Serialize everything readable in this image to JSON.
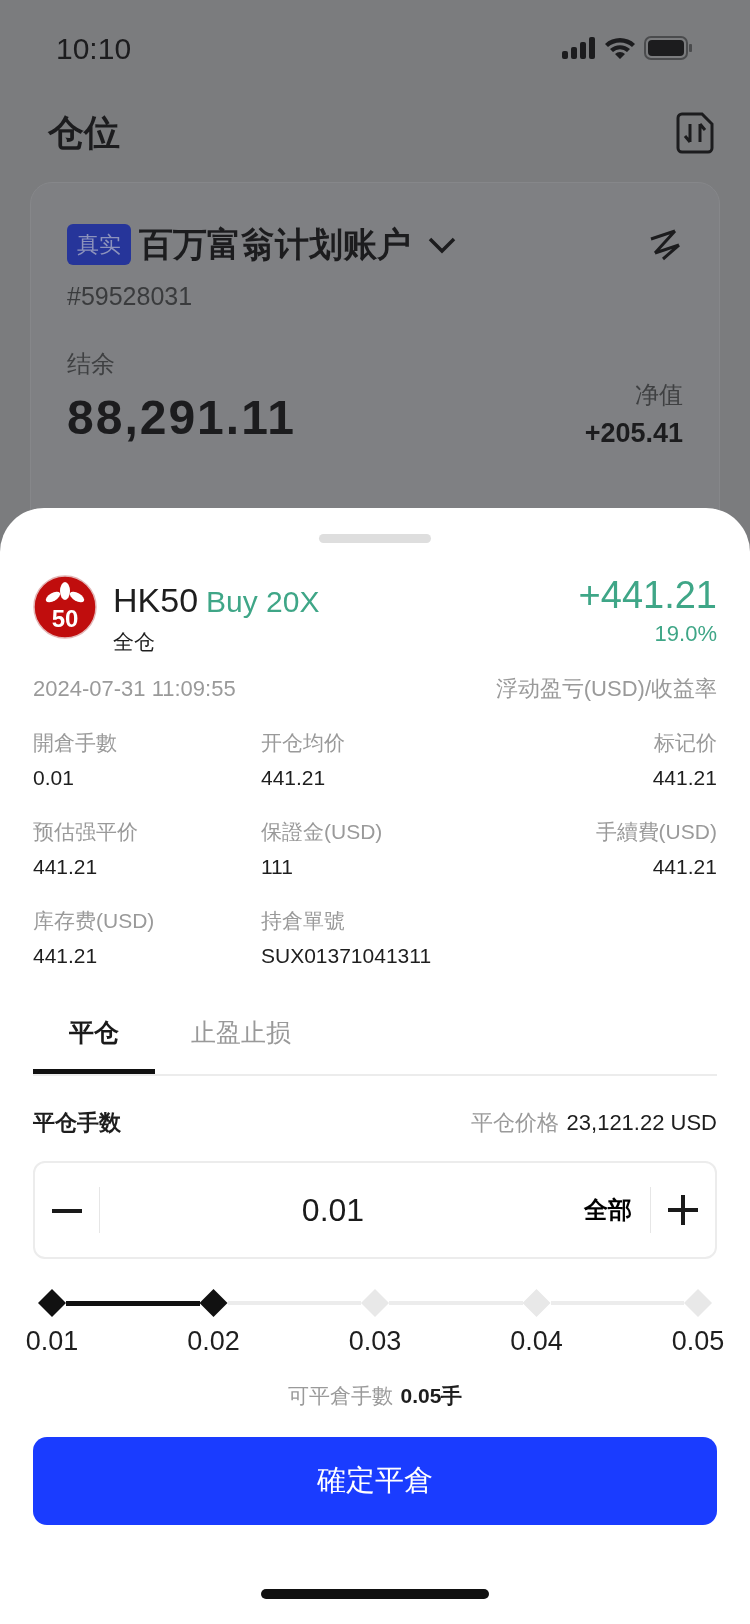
{
  "status_bar": {
    "time": "10:10"
  },
  "page": {
    "title": "仓位"
  },
  "account": {
    "badge": "真实",
    "name": "百万富翁计划账户",
    "number": "#59528031",
    "balance_label": "结余",
    "balance": "88,291.11",
    "equity_label": "净值",
    "equity": "+205.41"
  },
  "sheet": {
    "symbol": "HK50",
    "logo_text": "50",
    "side": "Buy 20X",
    "margin_mode": "全仓",
    "pnl": "+441.21",
    "pnl_rate": "19.0%",
    "time": "2024-07-31 11:09:55",
    "pnl_caption": "浮动盈亏(USD)/收益率",
    "details": [
      {
        "label": "開倉手數",
        "value": "0.01"
      },
      {
        "label": "开仓均价",
        "value": "441.21"
      },
      {
        "label": "标记价",
        "value": "441.21"
      },
      {
        "label": "预估强平价",
        "value": "441.21"
      },
      {
        "label": "保證金(USD)",
        "value": "111"
      },
      {
        "label": "手續費(USD)",
        "value": "441.21"
      },
      {
        "label": "库存费(USD)",
        "value": "441.21"
      },
      {
        "label": "持倉單號",
        "value": "SUX01371041311"
      }
    ],
    "tabs": [
      {
        "label": "平仓",
        "selected": true
      },
      {
        "label": "止盈止损",
        "selected": false
      }
    ],
    "close_lots_label": "平仓手数",
    "close_price_label": "平仓价格",
    "close_price": "23,121.22 USD",
    "stepper": {
      "value": "0.01",
      "all_label": "全部"
    },
    "slider": {
      "level": 0.25,
      "marks": [
        "0.01",
        "0.02",
        "0.03",
        "0.04",
        "0.05"
      ]
    },
    "available_label": "可平倉手數",
    "available": "0.05手",
    "confirm_button": "確定平倉"
  }
}
